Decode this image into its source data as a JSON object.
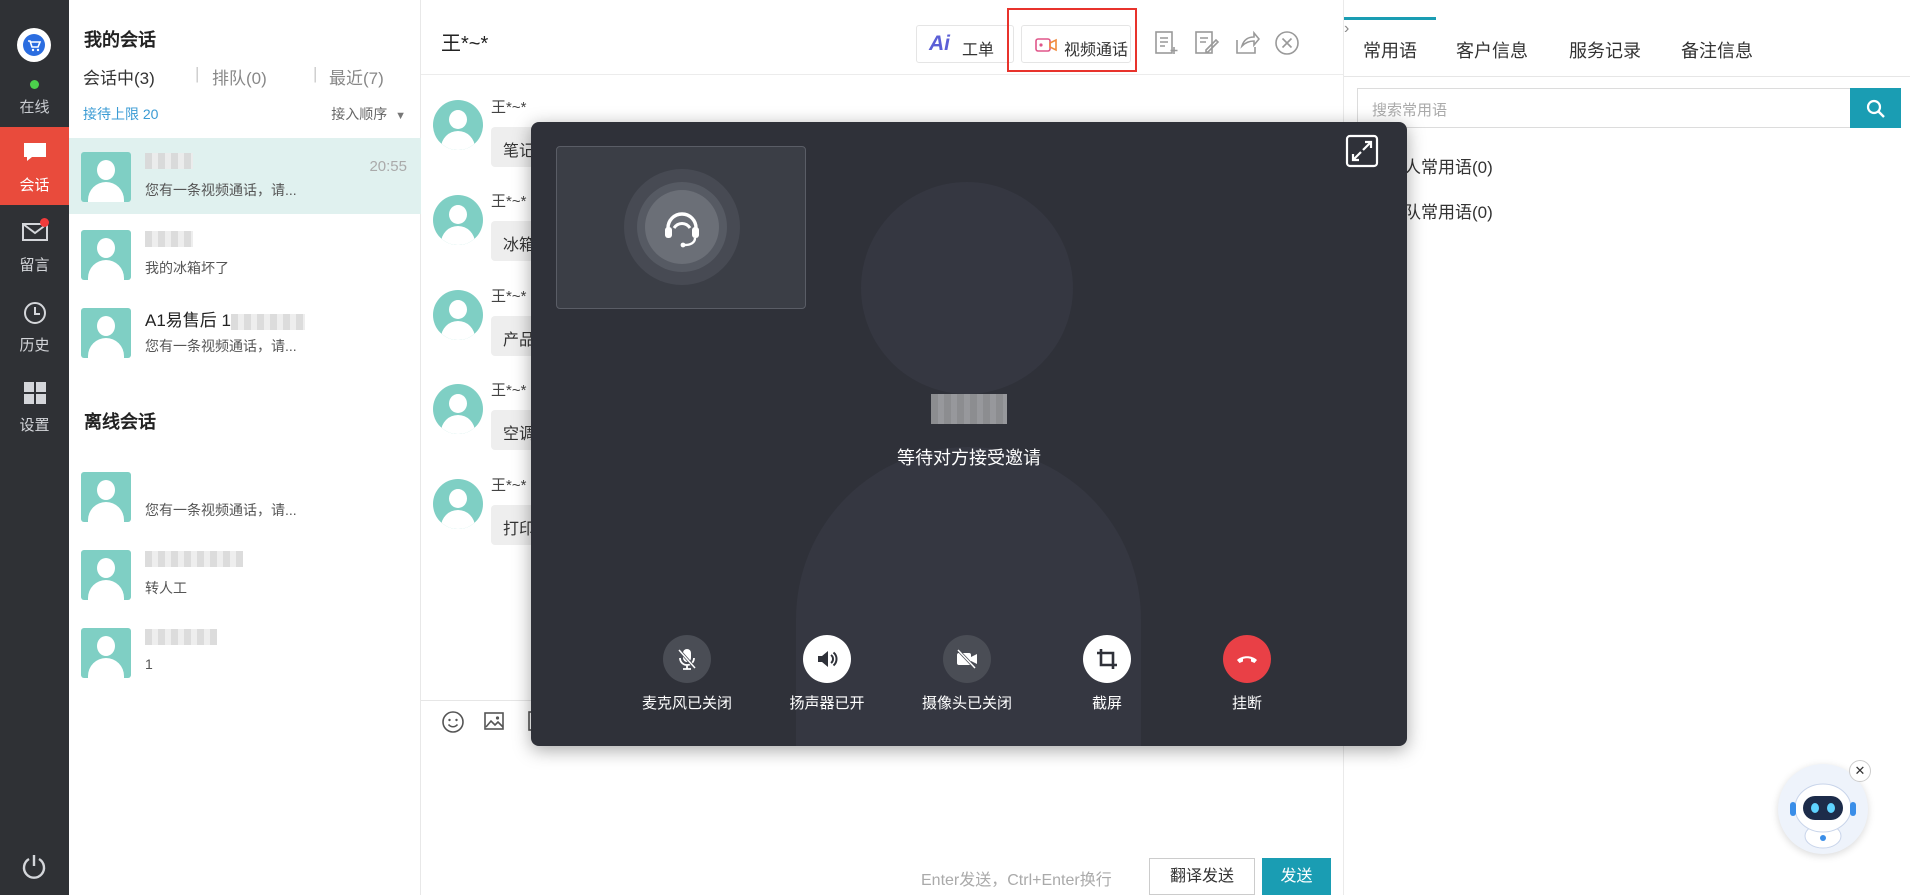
{
  "nav": {
    "status": "在线",
    "items": [
      {
        "label": "会话",
        "icon": "chat-icon"
      },
      {
        "label": "留言",
        "icon": "mail-icon"
      },
      {
        "label": "历史",
        "icon": "clock-icon"
      },
      {
        "label": "设置",
        "icon": "grid-icon"
      }
    ],
    "colors": {
      "rail": "#2f3135",
      "active": "#e94b3c",
      "online": "#4cd04c",
      "badge": "#f23b3b"
    }
  },
  "conversations": {
    "title": "我的会话",
    "tabs": [
      {
        "label": "会话中(3)"
      },
      {
        "label": "排队(0)"
      },
      {
        "label": "最近(7)"
      }
    ],
    "limit": "接待上限 20",
    "order": "接入顺序",
    "active": [
      {
        "name": "",
        "msg": "您有一条视频通话，请...",
        "time": "20:55"
      },
      {
        "name": "",
        "msg": "我的冰箱坏了",
        "time": ""
      },
      {
        "name": "A1易售后 1",
        "msg": "您有一条视频通话，请...",
        "time": ""
      }
    ],
    "offline_title": "离线会话",
    "offline": [
      {
        "name": "",
        "msg": "您有一条视频通话，请..."
      },
      {
        "name": "",
        "msg": "转人工"
      },
      {
        "name": "",
        "msg": "1"
      }
    ]
  },
  "chat": {
    "title": "王*~*",
    "toolbar": {
      "ticket": "工单",
      "video_call": "视频通话"
    },
    "messages": [
      {
        "name": "王*~*",
        "text": "笔记"
      },
      {
        "name": "王*~*",
        "text": "冰箱"
      },
      {
        "name": "王*~*",
        "text": "产品"
      },
      {
        "name": "王*~*",
        "text": "空调"
      },
      {
        "name": "王*~*",
        "text": "打印"
      }
    ],
    "hint": "Enter发送，Ctrl+Enter换行",
    "translate_send": "翻译发送",
    "send": "发送",
    "accent": "#1a9db3"
  },
  "right_panel": {
    "tabs": [
      "常用语",
      "客户信息",
      "服务记录",
      "备注信息"
    ],
    "search_placeholder": "搜索常用语",
    "groups": [
      "人常用语(0)",
      "队常用语(0)"
    ]
  },
  "video_modal": {
    "status": "等待对方接受邀请",
    "controls": [
      {
        "label": "麦克风已关闭",
        "icon": "mic-off-icon"
      },
      {
        "label": "扬声器已开",
        "icon": "speaker-icon"
      },
      {
        "label": "摄像头已关闭",
        "icon": "camera-off-icon"
      },
      {
        "label": "截屏",
        "icon": "crop-icon"
      },
      {
        "label": "挂断",
        "icon": "hangup-icon"
      }
    ],
    "colors": {
      "bg": "#2f3139",
      "hangup": "#e94046"
    }
  }
}
